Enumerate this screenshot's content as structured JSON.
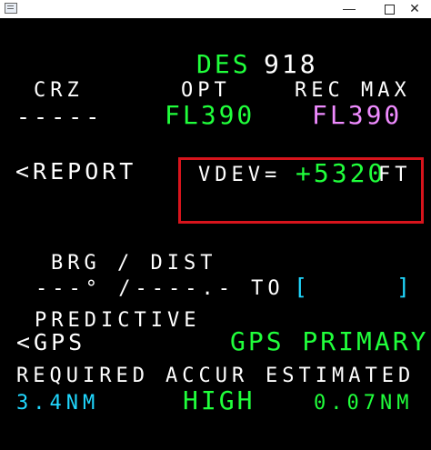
{
  "window": {
    "minimize": "—",
    "maximize": "□",
    "close": "✕"
  },
  "fmc": {
    "title": "DES",
    "title_value": "918",
    "headers": {
      "crz": "CRZ",
      "opt": "OPT",
      "rec_max": "REC MAX"
    },
    "values": {
      "crz": "-----",
      "opt": "FL390",
      "rec_max": "FL390"
    },
    "report": "<REPORT",
    "vdev_label": "VDEV=",
    "vdev_value": "+5320",
    "vdev_unit": "FT",
    "brg_dist": "BRG / DIST",
    "brg_line": "---° /----.- TO",
    "bracket_left": "[",
    "bracket_right": "]",
    "predictive": "PREDICTIVE",
    "gps_label": "<GPS",
    "gps_primary": "GPS PRIMARY",
    "required": "REQUIRED",
    "accur": "ACCUR",
    "estimated": "ESTIMATED",
    "required_value": "3.4NM",
    "accuracy": "HIGH",
    "estimated_value": "0.07NM"
  },
  "colors": {
    "green": "#20ff3b",
    "magenta": "#ef8bff",
    "cyan": "#20d8ff",
    "highlight": "#d8141c"
  }
}
